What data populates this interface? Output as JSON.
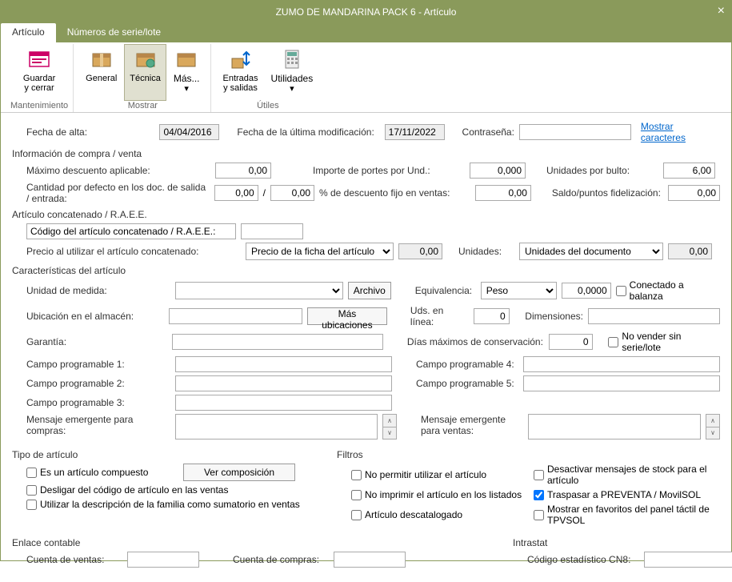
{
  "window": {
    "title": "ZUMO DE MANDARINA PACK 6 - Artículo"
  },
  "tabs": {
    "articulo": "Artículo",
    "series": "Números de serie/lote"
  },
  "ribbon": {
    "guardar": "Guardar\ny cerrar",
    "general": "General",
    "tecnica": "Técnica",
    "mas": "Más...",
    "entradas": "Entradas\ny salidas",
    "utilidades": "Utilidades",
    "g1": "Mantenimiento",
    "g2": "Mostrar",
    "g3": "Útiles"
  },
  "top": {
    "fecha_alta_l": "Fecha de alta:",
    "fecha_alta_v": "04/04/2016",
    "fecha_mod_l": "Fecha de la última modificación:",
    "fecha_mod_v": "17/11/2022",
    "contra_l": "Contraseña:",
    "contra_v": "",
    "mostrar": "Mostrar caracteres"
  },
  "compra": {
    "head": "Información de compra / venta",
    "max_desc_l": "Máximo descuento aplicable:",
    "max_desc_v": "0,00",
    "cant_def_l": "Cantidad por defecto en los doc. de salida / entrada:",
    "cant_def_1": "0,00",
    "cant_def_2": "0,00",
    "importe_l": "Importe de portes por Und.:",
    "importe_v": "0,000",
    "pct_l": "% de descuento fijo en ventas:",
    "pct_v": "0,00",
    "uds_bulto_l": "Unidades por bulto:",
    "uds_bulto_v": "6,00",
    "saldo_l": "Saldo/puntos fidelización:",
    "saldo_v": "0,00"
  },
  "concat": {
    "head": "Artículo concatenado / R.A.E.E.",
    "cod_l": "Código del artículo concatenado / R.A.E.E.:",
    "cod_v": "",
    "precio_l": "Precio al utilizar el artículo concatenado:",
    "precio_sel": "Precio de la ficha del artículo",
    "precio_n": "0,00",
    "uds_l": "Unidades:",
    "uds_sel": "Unidades del documento",
    "uds_n": "0,00"
  },
  "carac": {
    "head": "Características del artículo",
    "um_l": "Unidad de medida:",
    "archivo": "Archivo",
    "equiv_l": "Equivalencia:",
    "equiv_sel": "Peso",
    "equiv_v": "0,0000",
    "conectado": "Conectado a balanza",
    "ubic_l": "Ubicación en el almacén:",
    "mas_ubic": "Más ubicaciones",
    "uds_linea_l": "Uds. en línea:",
    "uds_linea_v": "0",
    "dim_l": "Dimensiones:",
    "dim_v": "",
    "garantia_l": "Garantía:",
    "dias_l": "Días máximos de conservación:",
    "dias_v": "0",
    "no_vender": "No vender sin serie/lote",
    "cp1": "Campo programable 1:",
    "cp2": "Campo programable 2:",
    "cp3": "Campo programable 3:",
    "cp4": "Campo programable 4:",
    "cp5": "Campo programable 5:",
    "msg_c_l": "Mensaje emergente para compras:",
    "msg_v_l": "Mensaje emergente para ventas:"
  },
  "tipo": {
    "head": "Tipo de artículo",
    "compuesto": "Es un artículo compuesto",
    "ver_comp": "Ver composición",
    "desligar": "Desligar del código de artículo en las ventas",
    "util_desc": "Utilizar la descripción de la familia como sumatorio en ventas"
  },
  "filtros": {
    "head": "Filtros",
    "no_permitir": "No permitir utilizar el artículo",
    "no_imprimir": "No imprimir el artículo en los listados",
    "descat": "Artículo descatalogado",
    "desact_stock": "Desactivar mensajes de stock para el artículo",
    "traspasar": "Traspasar a PREVENTA / MovilSOL",
    "mostrar_fav": "Mostrar en favoritos del panel táctil de TPVSOL"
  },
  "contab": {
    "head": "Enlace contable",
    "cv_l": "Cuenta de ventas:",
    "cc_l": "Cuenta de compras:"
  },
  "intra": {
    "head": "Intrastat",
    "cn8_l": "Código estadístico CN8:"
  }
}
